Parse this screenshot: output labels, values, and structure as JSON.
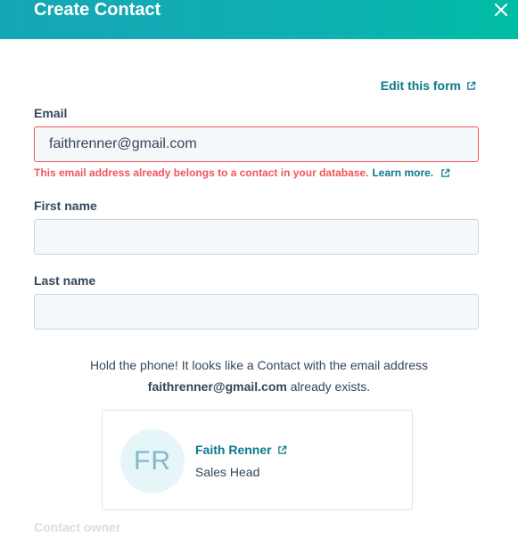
{
  "header": {
    "title": "Create Contact"
  },
  "form": {
    "edit_link": "Edit this form",
    "email": {
      "label": "Email",
      "value": "faithrenner@gmail.com",
      "error_text": "This email address already belongs to a contact in your database.",
      "learn_more": "Learn more."
    },
    "first_name": {
      "label": "First name",
      "value": ""
    },
    "last_name": {
      "label": "Last name",
      "value": ""
    },
    "duplicate_notice": {
      "line1": "Hold the phone! It looks like a Contact with the email address",
      "email": "faithrenner@gmail.com",
      "suffix": " already exists."
    },
    "existing_contact": {
      "initials": "FR",
      "name": "Faith Renner",
      "job_title": "Sales Head"
    },
    "contact_owner_label": "Contact owner"
  },
  "colors": {
    "accent": "#0b7a8c",
    "error": "#f2545b",
    "header_start": "#16a5b4",
    "header_end": "#00bda5"
  },
  "icons": {
    "close": "close-icon",
    "external": "external-link-icon"
  }
}
